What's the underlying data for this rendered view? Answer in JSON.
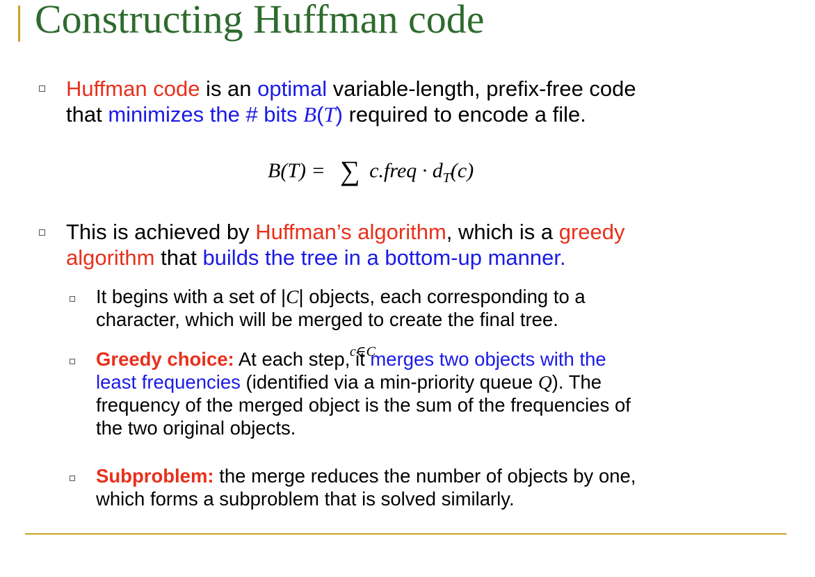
{
  "title": "Constructing Huffman code",
  "bullet1": {
    "p1": "Huffman code",
    "p2": " is an ",
    "p3": "optimal",
    "p4": " variable-length, prefix-free code",
    "p5": "that ",
    "p6": "minimizes the # bits ",
    "p7": "B",
    "p8": "(",
    "p9": "T",
    "p10": ")",
    "p11": " required to encode a file."
  },
  "formula": {
    "lhs": "B(T) = ",
    "sum": "∑",
    "rhs": "c.freq · d",
    "rhs_sub": "T",
    "rhs_end": "(c)",
    "sum_under": "c∈C"
  },
  "bullet2": {
    "p1": "This is achieved by ",
    "p2": "Huffman’s algorithm",
    "p3": ", which is a ",
    "p4": "greedy",
    "p5": "algorithm",
    "p6": " that ",
    "p7": "builds the tree in a bottom-up manner."
  },
  "sub1": {
    "p1": "It begins with a set of |",
    "p2": "C",
    "p3": "| objects, each corresponding to a",
    "p4": "character, which will be merged to create the final tree."
  },
  "sub2": {
    "p1": "Greedy choice:",
    "p2": " At each step, it ",
    "p3": "merges two objects with the",
    "p4": "least frequencies",
    "p5": " (identified via a min-priority queue ",
    "p6": "Q",
    "p7": "). The",
    "p8": "frequency of the merged object is the sum of the frequencies of",
    "p9": "the two original objects."
  },
  "sub3": {
    "p1": "Subproblem:",
    "p2": " the merge reduces the number of objects by one,",
    "p3": "which forms a subproblem that is solved similarly."
  },
  "colors": {
    "title": "#2E6B2E",
    "accent_red": "#E8301C",
    "accent_blue": "#1A1AE6",
    "rule": "#C9A227"
  }
}
